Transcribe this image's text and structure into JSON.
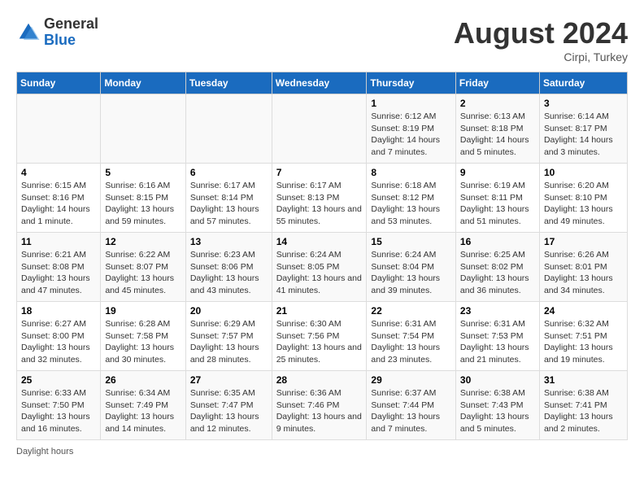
{
  "logo": {
    "general": "General",
    "blue": "Blue"
  },
  "title": {
    "month_year": "August 2024",
    "location": "Cirpi, Turkey"
  },
  "days_of_week": [
    "Sunday",
    "Monday",
    "Tuesday",
    "Wednesday",
    "Thursday",
    "Friday",
    "Saturday"
  ],
  "weeks": [
    [
      {
        "day": "",
        "info": ""
      },
      {
        "day": "",
        "info": ""
      },
      {
        "day": "",
        "info": ""
      },
      {
        "day": "",
        "info": ""
      },
      {
        "day": "1",
        "info": "Sunrise: 6:12 AM\nSunset: 8:19 PM\nDaylight: 14 hours and 7 minutes."
      },
      {
        "day": "2",
        "info": "Sunrise: 6:13 AM\nSunset: 8:18 PM\nDaylight: 14 hours and 5 minutes."
      },
      {
        "day": "3",
        "info": "Sunrise: 6:14 AM\nSunset: 8:17 PM\nDaylight: 14 hours and 3 minutes."
      }
    ],
    [
      {
        "day": "4",
        "info": "Sunrise: 6:15 AM\nSunset: 8:16 PM\nDaylight: 14 hours and 1 minute."
      },
      {
        "day": "5",
        "info": "Sunrise: 6:16 AM\nSunset: 8:15 PM\nDaylight: 13 hours and 59 minutes."
      },
      {
        "day": "6",
        "info": "Sunrise: 6:17 AM\nSunset: 8:14 PM\nDaylight: 13 hours and 57 minutes."
      },
      {
        "day": "7",
        "info": "Sunrise: 6:17 AM\nSunset: 8:13 PM\nDaylight: 13 hours and 55 minutes."
      },
      {
        "day": "8",
        "info": "Sunrise: 6:18 AM\nSunset: 8:12 PM\nDaylight: 13 hours and 53 minutes."
      },
      {
        "day": "9",
        "info": "Sunrise: 6:19 AM\nSunset: 8:11 PM\nDaylight: 13 hours and 51 minutes."
      },
      {
        "day": "10",
        "info": "Sunrise: 6:20 AM\nSunset: 8:10 PM\nDaylight: 13 hours and 49 minutes."
      }
    ],
    [
      {
        "day": "11",
        "info": "Sunrise: 6:21 AM\nSunset: 8:08 PM\nDaylight: 13 hours and 47 minutes."
      },
      {
        "day": "12",
        "info": "Sunrise: 6:22 AM\nSunset: 8:07 PM\nDaylight: 13 hours and 45 minutes."
      },
      {
        "day": "13",
        "info": "Sunrise: 6:23 AM\nSunset: 8:06 PM\nDaylight: 13 hours and 43 minutes."
      },
      {
        "day": "14",
        "info": "Sunrise: 6:24 AM\nSunset: 8:05 PM\nDaylight: 13 hours and 41 minutes."
      },
      {
        "day": "15",
        "info": "Sunrise: 6:24 AM\nSunset: 8:04 PM\nDaylight: 13 hours and 39 minutes."
      },
      {
        "day": "16",
        "info": "Sunrise: 6:25 AM\nSunset: 8:02 PM\nDaylight: 13 hours and 36 minutes."
      },
      {
        "day": "17",
        "info": "Sunrise: 6:26 AM\nSunset: 8:01 PM\nDaylight: 13 hours and 34 minutes."
      }
    ],
    [
      {
        "day": "18",
        "info": "Sunrise: 6:27 AM\nSunset: 8:00 PM\nDaylight: 13 hours and 32 minutes."
      },
      {
        "day": "19",
        "info": "Sunrise: 6:28 AM\nSunset: 7:58 PM\nDaylight: 13 hours and 30 minutes."
      },
      {
        "day": "20",
        "info": "Sunrise: 6:29 AM\nSunset: 7:57 PM\nDaylight: 13 hours and 28 minutes."
      },
      {
        "day": "21",
        "info": "Sunrise: 6:30 AM\nSunset: 7:56 PM\nDaylight: 13 hours and 25 minutes."
      },
      {
        "day": "22",
        "info": "Sunrise: 6:31 AM\nSunset: 7:54 PM\nDaylight: 13 hours and 23 minutes."
      },
      {
        "day": "23",
        "info": "Sunrise: 6:31 AM\nSunset: 7:53 PM\nDaylight: 13 hours and 21 minutes."
      },
      {
        "day": "24",
        "info": "Sunrise: 6:32 AM\nSunset: 7:51 PM\nDaylight: 13 hours and 19 minutes."
      }
    ],
    [
      {
        "day": "25",
        "info": "Sunrise: 6:33 AM\nSunset: 7:50 PM\nDaylight: 13 hours and 16 minutes."
      },
      {
        "day": "26",
        "info": "Sunrise: 6:34 AM\nSunset: 7:49 PM\nDaylight: 13 hours and 14 minutes."
      },
      {
        "day": "27",
        "info": "Sunrise: 6:35 AM\nSunset: 7:47 PM\nDaylight: 13 hours and 12 minutes."
      },
      {
        "day": "28",
        "info": "Sunrise: 6:36 AM\nSunset: 7:46 PM\nDaylight: 13 hours and 9 minutes."
      },
      {
        "day": "29",
        "info": "Sunrise: 6:37 AM\nSunset: 7:44 PM\nDaylight: 13 hours and 7 minutes."
      },
      {
        "day": "30",
        "info": "Sunrise: 6:38 AM\nSunset: 7:43 PM\nDaylight: 13 hours and 5 minutes."
      },
      {
        "day": "31",
        "info": "Sunrise: 6:38 AM\nSunset: 7:41 PM\nDaylight: 13 hours and 2 minutes."
      }
    ]
  ],
  "footer": {
    "daylight_label": "Daylight hours"
  }
}
